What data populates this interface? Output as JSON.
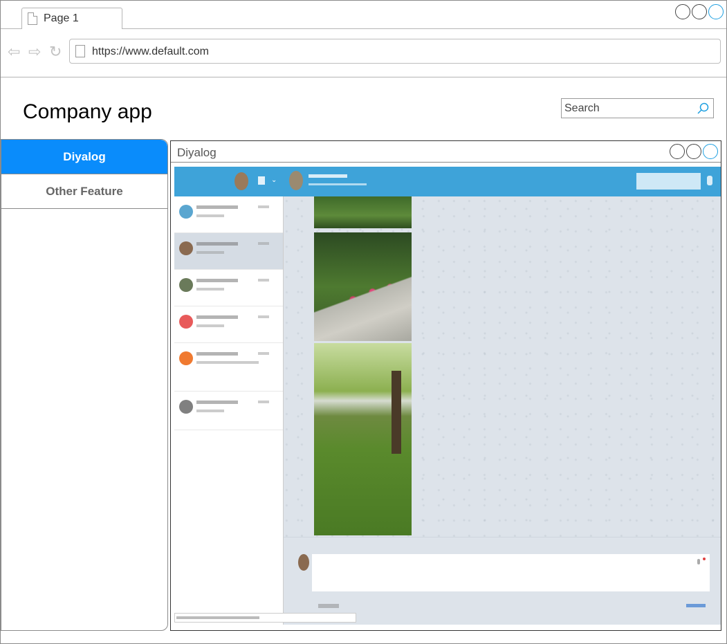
{
  "browser": {
    "tab_label": "Page 1",
    "url": "https://www.default.com"
  },
  "header": {
    "app_title": "Company app",
    "search_placeholder": "Search"
  },
  "sidebar": {
    "items": [
      {
        "label": "Diyalog",
        "active": true
      },
      {
        "label": "Other Feature",
        "active": false
      }
    ]
  },
  "panel": {
    "title": "Diyalog"
  },
  "colors": {
    "accent": "#0a8cfb",
    "messenger_header": "#3ea3d9",
    "chat_background": "#dde3ea"
  }
}
